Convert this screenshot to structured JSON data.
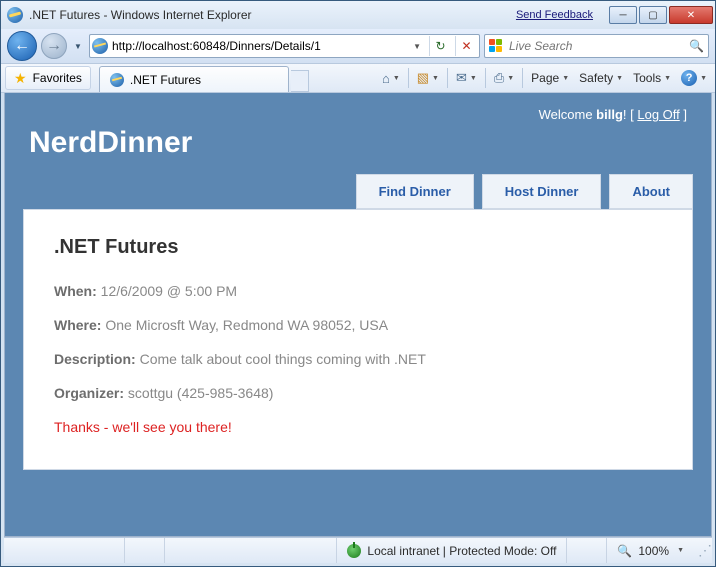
{
  "window": {
    "title": ".NET Futures - Windows Internet Explorer",
    "feedback": "Send Feedback"
  },
  "address": {
    "url": "http://localhost:60848/Dinners/Details/1"
  },
  "search": {
    "placeholder": "Live Search"
  },
  "favorites": {
    "label": "Favorites"
  },
  "tab": {
    "title": ".NET Futures"
  },
  "cmd": {
    "page": "Page",
    "safety": "Safety",
    "tools": "Tools"
  },
  "site": {
    "logo": "NerdDinner",
    "welcome_prefix": "Welcome ",
    "user": "billg",
    "welcome_suffix": "! ",
    "logoff": "Log Off",
    "nav": {
      "find": "Find Dinner",
      "host": "Host Dinner",
      "about": "About"
    }
  },
  "dinner": {
    "title": ".NET Futures",
    "when_label": "When:",
    "when_value": "12/6/2009 @ 5:00 PM",
    "where_label": "Where:",
    "where_value": "One Microsft Way, Redmond WA 98052, USA",
    "desc_label": "Description:",
    "desc_value": "Come talk about cool things coming with .NET",
    "org_label": "Organizer:",
    "org_value": "scottgu (425-985-3648)",
    "thanks": "Thanks - we'll see you there!"
  },
  "status": {
    "zone": "Local intranet | Protected Mode: Off",
    "zoom": "100%"
  }
}
